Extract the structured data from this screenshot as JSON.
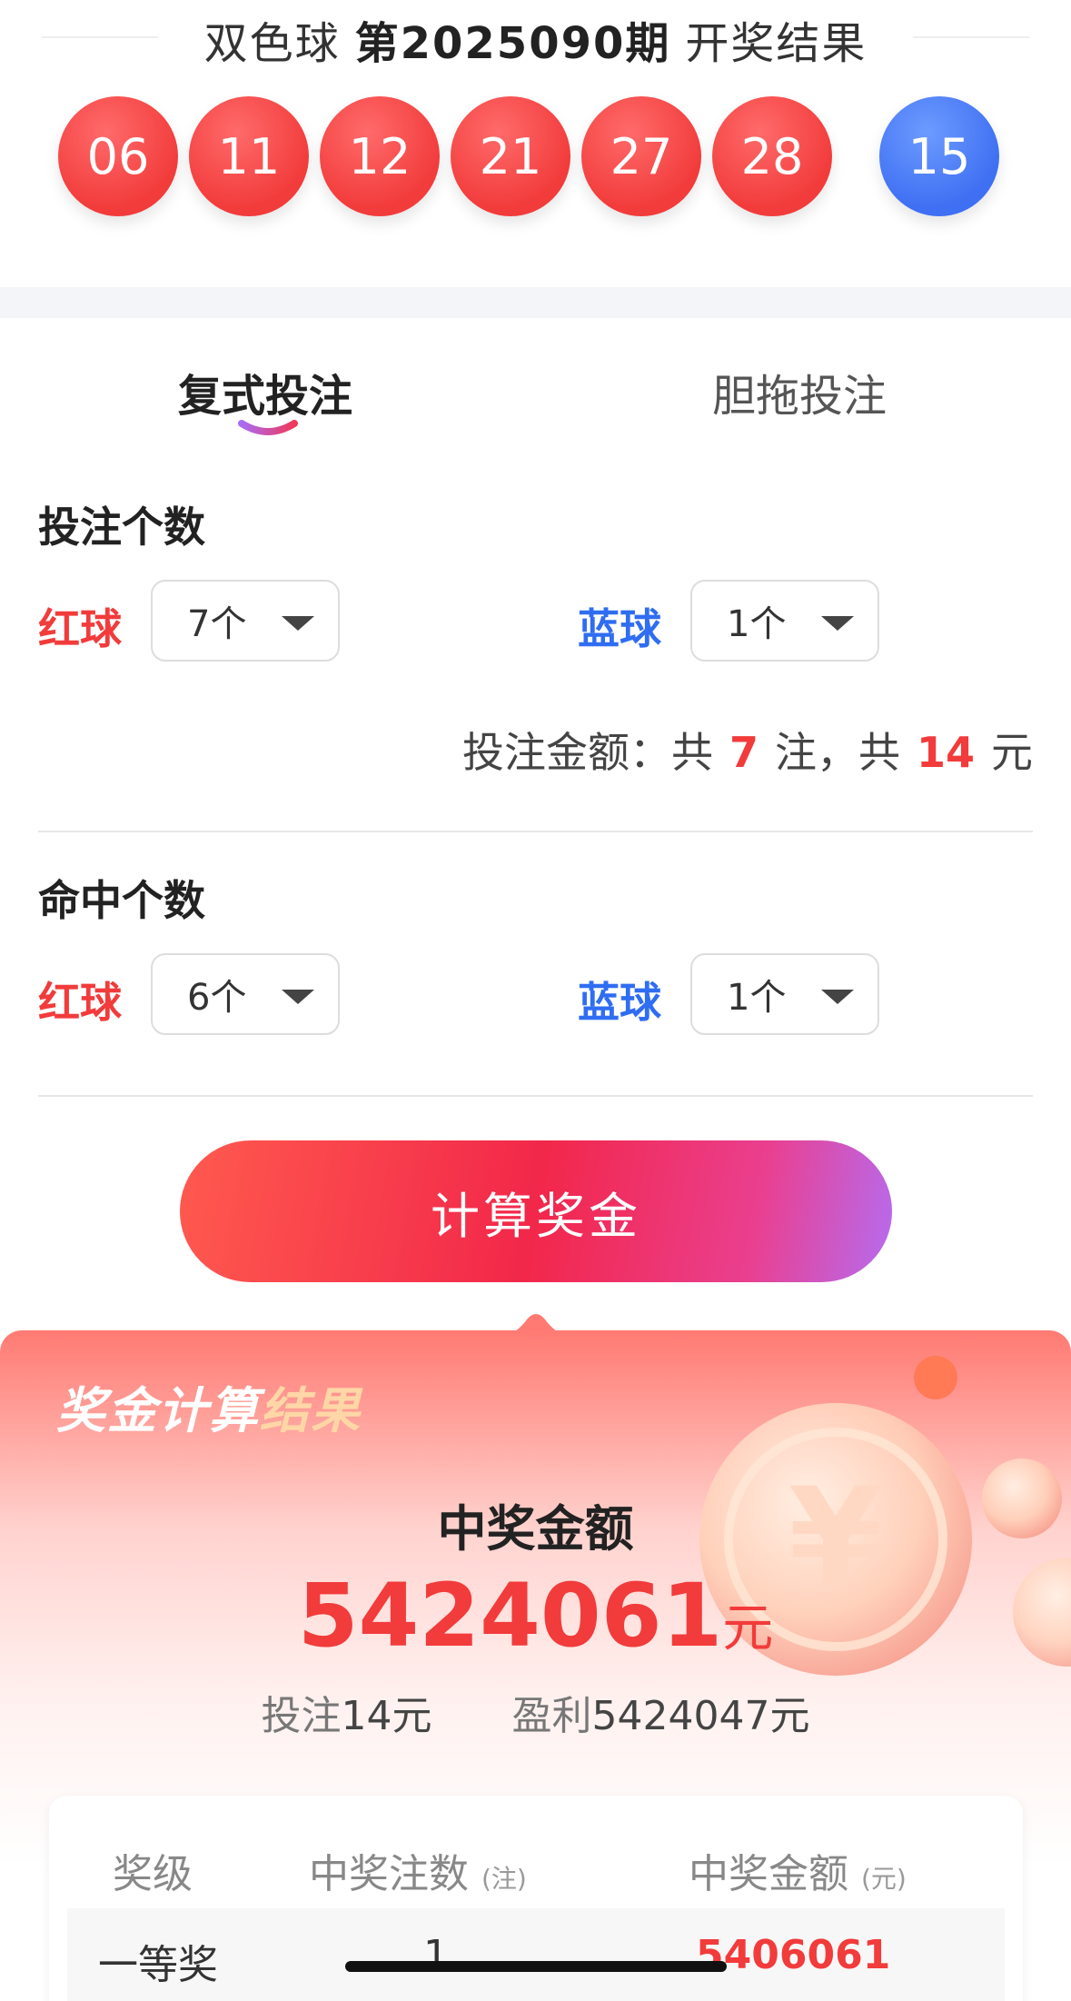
{
  "header": {
    "lottery_name": "双色球",
    "issue": "第2025090期",
    "result_label": "开奖结果"
  },
  "draw": {
    "red_balls": [
      "06",
      "11",
      "12",
      "21",
      "27",
      "28"
    ],
    "blue_ball": "15"
  },
  "tabs": [
    {
      "label": "复式投注",
      "active": true
    },
    {
      "label": "胆拖投注",
      "active": false
    }
  ],
  "bet_section": {
    "title": "投注个数",
    "red_label": "红球",
    "red_value": "7个",
    "blue_label": "蓝球",
    "blue_value": "1个",
    "summary_prefix": "投注金额：共",
    "bet_count": "7",
    "summary_mid": "注，共",
    "bet_amount": "14",
    "summary_suffix": "元"
  },
  "hit_section": {
    "title": "命中个数",
    "red_label": "红球",
    "red_value": "6个",
    "blue_label": "蓝球",
    "blue_value": "1个"
  },
  "calculate_button": "计算奖金",
  "result": {
    "title_part1": "奖金计算",
    "title_part2": "结果",
    "amount_label": "中奖金额",
    "amount_value": "5424061",
    "amount_unit": "元",
    "bet_label": "投注",
    "bet_value": "14元",
    "profit_label": "盈利",
    "profit_value": "5424047元",
    "table": {
      "col_level": "奖级",
      "col_count": "中奖注数",
      "col_count_unit": "(注)",
      "col_amount": "中奖金额",
      "col_amount_unit": "(元)",
      "rows": [
        {
          "level": "一等奖",
          "count": "1",
          "amount": "5406061"
        }
      ]
    }
  },
  "colors": {
    "red": "#f23b3b",
    "blue": "#2f6df2",
    "button_gradient": [
      "#ff5a4e",
      "#f2274a",
      "#b56cf0"
    ]
  }
}
